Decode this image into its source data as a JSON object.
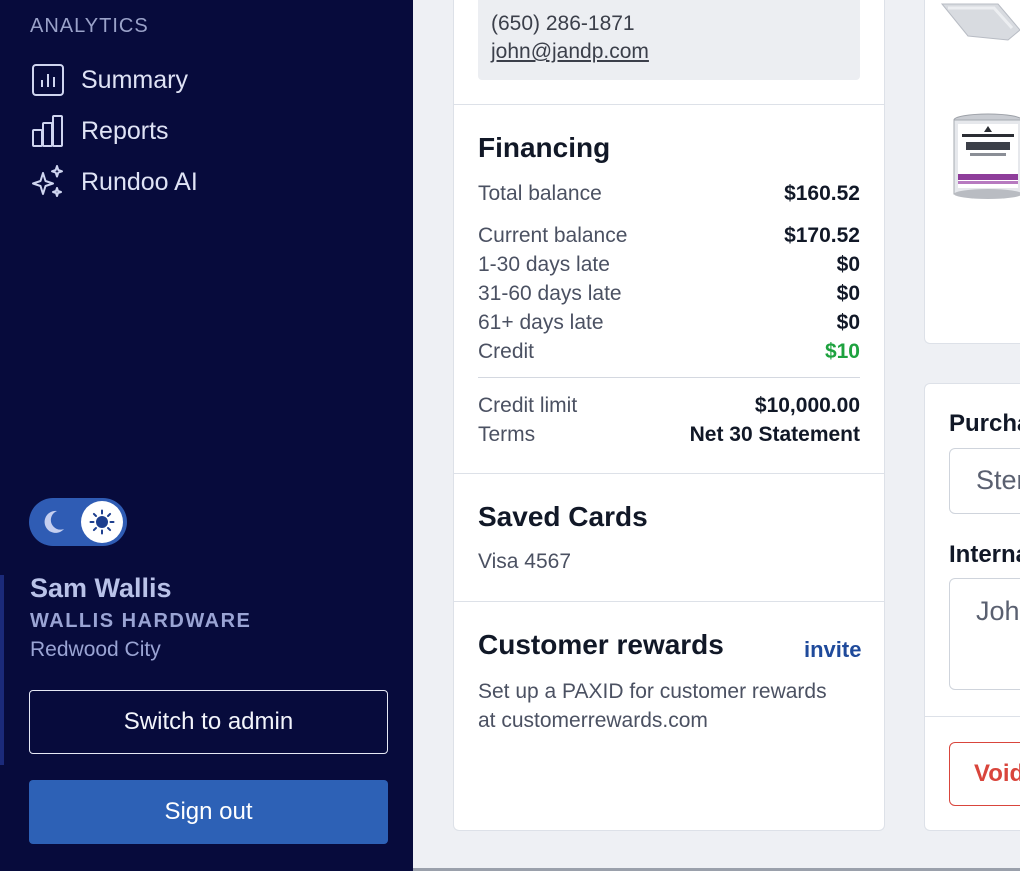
{
  "sidebar": {
    "section_label": "ANALYTICS",
    "items": [
      {
        "label": "Summary",
        "icon": "bar-chart-icon"
      },
      {
        "label": "Reports",
        "icon": "reports-icon"
      },
      {
        "label": "Rundoo AI",
        "icon": "sparkles-icon"
      }
    ],
    "theme_toggle": {
      "mode": "light",
      "icons": [
        "moon-icon",
        "sun-icon"
      ]
    },
    "user": {
      "name": "Sam Wallis",
      "company": "WALLIS HARDWARE",
      "city": "Redwood City"
    },
    "switch_admin_label": "Switch to admin",
    "sign_out_label": "Sign out"
  },
  "contact": {
    "phone": "(650) 286-1871",
    "email": "john@jandp.com"
  },
  "financing": {
    "title": "Financing",
    "rows": [
      {
        "label": "Total balance",
        "value": "$160.52"
      },
      {
        "label": "Current balance",
        "value": "$170.52"
      },
      {
        "label": "1-30 days late",
        "value": "$0"
      },
      {
        "label": "31-60 days late",
        "value": "$0"
      },
      {
        "label": "61+ days late",
        "value": "$0"
      },
      {
        "label": "Credit",
        "value": "$10"
      },
      {
        "label": "Credit limit",
        "value": "$10,000.00"
      },
      {
        "label": "Terms",
        "value": "Net 30 Statement"
      }
    ]
  },
  "saved_cards": {
    "title": "Saved Cards",
    "cards": [
      "Visa 4567"
    ]
  },
  "rewards": {
    "title": "Customer rewards",
    "invite_label": "invite",
    "text": "Set up a PAXID for customer rewards\n at customerrewards.com"
  },
  "right_panel": {
    "purchase_label": "Purcha",
    "purchase_value": "Ster",
    "internal_label": "Interna",
    "internal_value": "Joh",
    "void_label": "Void"
  },
  "colors": {
    "sidebar_bg": "#070b3c",
    "accent_blue": "#2d61b6",
    "credit_green": "#1ea23f",
    "void_red": "#d9453c",
    "invite_blue": "#1f4a9b"
  }
}
